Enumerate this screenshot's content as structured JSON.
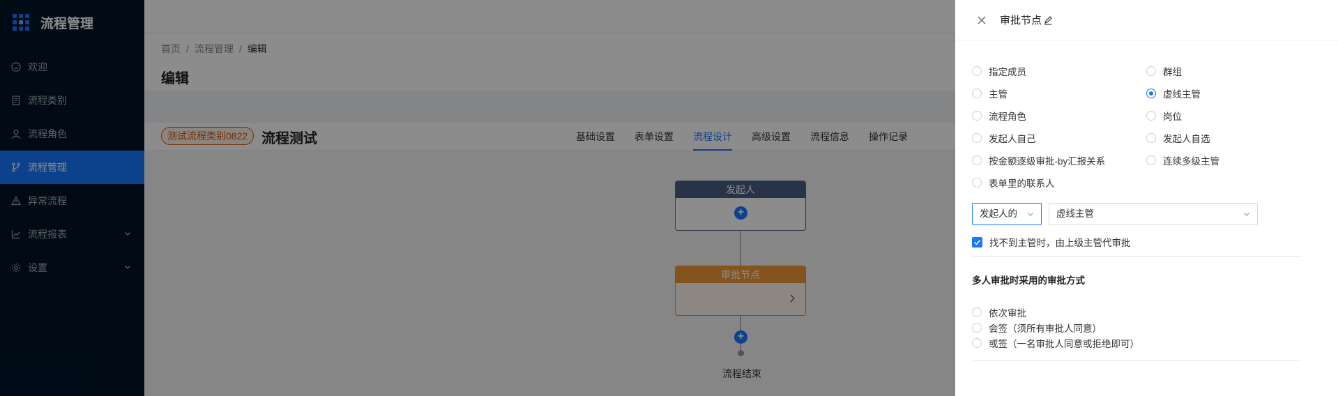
{
  "app": {
    "title": "流程管理"
  },
  "sidebar": {
    "items": [
      {
        "label": "欢迎",
        "icon": "smile-icon"
      },
      {
        "label": "流程类别",
        "icon": "file-icon"
      },
      {
        "label": "流程角色",
        "icon": "user-icon"
      },
      {
        "label": "流程管理",
        "icon": "branch-icon",
        "active": true
      },
      {
        "label": "异常流程",
        "icon": "warning-icon"
      },
      {
        "label": "流程报表",
        "icon": "chart-icon",
        "expandable": true
      },
      {
        "label": "设置",
        "icon": "gear-icon",
        "expandable": true
      }
    ]
  },
  "breadcrumb": {
    "items": [
      "首页",
      "流程管理",
      "编辑"
    ],
    "separator": "/"
  },
  "page": {
    "title": "编辑"
  },
  "flow": {
    "category_tag": "测试流程类别0822",
    "name": "流程测试",
    "tabs": [
      "基础设置",
      "表单设置",
      "流程设计",
      "高级设置",
      "流程信息",
      "操作记录"
    ],
    "active_tab": "流程设计"
  },
  "canvas": {
    "start_node": "发起人",
    "approve_node": "审批节点",
    "end_label": "流程结束"
  },
  "drawer": {
    "title": "审批节点",
    "approver_options_left": [
      "指定成员",
      "主管",
      "流程角色",
      "发起人自己",
      "按金额逐级审批-by汇报关系",
      "表单里的联系人"
    ],
    "approver_options_right": [
      "群组",
      "虚线主管",
      "岗位",
      "发起人自选",
      "连续多级主管"
    ],
    "selected_option": "虚线主管",
    "select_scope": "发起人的",
    "select_manager": "虚线主管",
    "fallback_checkbox": "找不到主管时，由上级主管代审批",
    "fallback_checked": true,
    "multi_title": "多人审批时采用的审批方式",
    "multi_options": [
      "依次审批",
      "会签（须所有审批人同意）",
      "或签（一名审批人同意或拒绝即可）"
    ]
  },
  "colors": {
    "primary": "#1677ff",
    "sidebar": "#001529",
    "tag": "#d4570e",
    "approve_node": "#f09a3a",
    "start_node": "#4a5d82"
  }
}
